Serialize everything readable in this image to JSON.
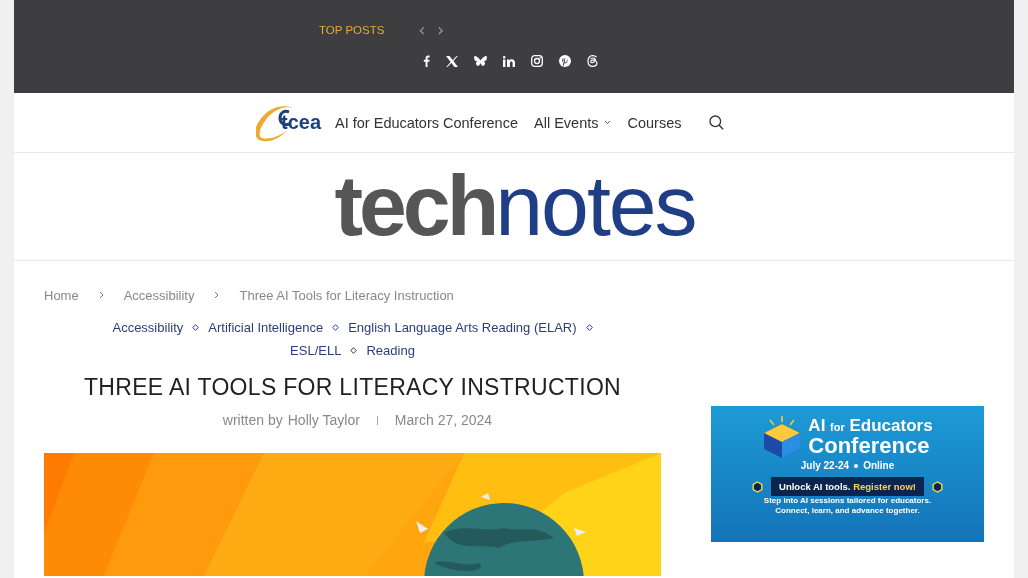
{
  "top_bar": {
    "label": "TOP POSTS",
    "prev": "‹",
    "next": "›"
  },
  "nav": {
    "logo": "tcea",
    "items": [
      {
        "label": "AI for Educators Conference",
        "has_menu": false
      },
      {
        "label": "All Events",
        "has_menu": true
      },
      {
        "label": "Courses",
        "has_menu": false
      }
    ]
  },
  "masthead": {
    "bold": "tech",
    "light": "notes"
  },
  "breadcrumbs": [
    "Home",
    "Accessibility",
    "Three AI Tools for Literacy Instruction"
  ],
  "categories": [
    "Accessibility",
    "Artificial Intelligence",
    "English Language Arts Reading (ELAR)",
    "ESL/ELL",
    "Reading"
  ],
  "article": {
    "title": "THREE AI TOOLS FOR LITERACY INSTRUCTION",
    "byline": "written by",
    "author": "Holly Taylor",
    "date": "March 27, 2024"
  },
  "ad": {
    "title_1": "AI",
    "title_small": "for",
    "title_2": "Educators",
    "title_3": "Conference",
    "dates": "July 22-24",
    "mode": "Online",
    "cta": "Unlock AI tools.",
    "cta_link": "Register now!",
    "tagline_1": "Step into AI sessions tailored for educators.",
    "tagline_2": "Connect, learn, and advance together."
  }
}
